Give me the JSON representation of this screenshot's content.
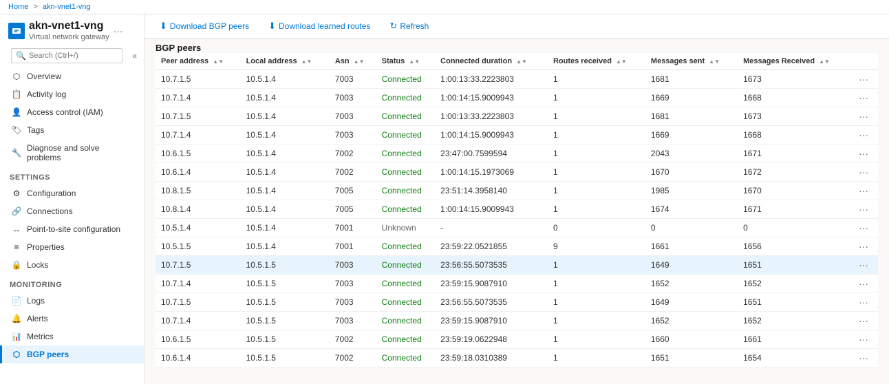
{
  "breadcrumb": {
    "home": "Home",
    "resource": "akn-vnet1-vng"
  },
  "header": {
    "resource_name": "akn-vnet1-vng",
    "separator": "|",
    "page_name": "BGP peers",
    "resource_type": "Virtual network gateway",
    "more_icon": "···"
  },
  "search": {
    "placeholder": "Search (Ctrl+/)"
  },
  "nav": {
    "top_items": [
      {
        "label": "Overview",
        "icon": "overview"
      },
      {
        "label": "Activity log",
        "icon": "activity"
      },
      {
        "label": "Access control (IAM)",
        "icon": "iam"
      },
      {
        "label": "Tags",
        "icon": "tags"
      },
      {
        "label": "Diagnose and solve problems",
        "icon": "diagnose"
      }
    ],
    "sections": [
      {
        "title": "Settings",
        "items": [
          {
            "label": "Configuration",
            "icon": "config"
          },
          {
            "label": "Connections",
            "icon": "connections"
          },
          {
            "label": "Point-to-site configuration",
            "icon": "p2s"
          },
          {
            "label": "Properties",
            "icon": "properties"
          },
          {
            "label": "Locks",
            "icon": "locks"
          }
        ]
      },
      {
        "title": "Monitoring",
        "items": [
          {
            "label": "Logs",
            "icon": "logs"
          },
          {
            "label": "Alerts",
            "icon": "alerts"
          },
          {
            "label": "Metrics",
            "icon": "metrics"
          },
          {
            "label": "BGP peers",
            "icon": "bgp",
            "active": true
          }
        ]
      }
    ]
  },
  "toolbar": {
    "download_bgp_label": "Download BGP peers",
    "download_routes_label": "Download learned routes",
    "refresh_label": "Refresh"
  },
  "table": {
    "section_label": "BGP peers",
    "columns": [
      "Peer address",
      "Local address",
      "Asn",
      "Status",
      "Connected duration",
      "Routes received",
      "Messages sent",
      "Messages Received"
    ],
    "rows": [
      {
        "peer": "10.7.1.5",
        "local": "10.5.1.4",
        "asn": "7003",
        "status": "Connected",
        "duration": "1:00:13:33.2223803",
        "routes": "1",
        "sent": "1681",
        "received": "1673",
        "selected": false
      },
      {
        "peer": "10.7.1.4",
        "local": "10.5.1.4",
        "asn": "7003",
        "status": "Connected",
        "duration": "1:00:14:15.9009943",
        "routes": "1",
        "sent": "1669",
        "received": "1668",
        "selected": false
      },
      {
        "peer": "10.7.1.5",
        "local": "10.5.1.4",
        "asn": "7003",
        "status": "Connected",
        "duration": "1:00:13:33.2223803",
        "routes": "1",
        "sent": "1681",
        "received": "1673",
        "selected": false
      },
      {
        "peer": "10.7.1.4",
        "local": "10.5.1.4",
        "asn": "7003",
        "status": "Connected",
        "duration": "1:00:14:15.9009943",
        "routes": "1",
        "sent": "1669",
        "received": "1668",
        "selected": false
      },
      {
        "peer": "10.6.1.5",
        "local": "10.5.1.4",
        "asn": "7002",
        "status": "Connected",
        "duration": "23:47:00.7599594",
        "routes": "1",
        "sent": "2043",
        "received": "1671",
        "selected": false
      },
      {
        "peer": "10.6.1.4",
        "local": "10.5.1.4",
        "asn": "7002",
        "status": "Connected",
        "duration": "1:00:14:15.1973069",
        "routes": "1",
        "sent": "1670",
        "received": "1672",
        "selected": false
      },
      {
        "peer": "10.8.1.5",
        "local": "10.5.1.4",
        "asn": "7005",
        "status": "Connected",
        "duration": "23:51:14.3958140",
        "routes": "1",
        "sent": "1985",
        "received": "1670",
        "selected": false
      },
      {
        "peer": "10.8.1.4",
        "local": "10.5.1.4",
        "asn": "7005",
        "status": "Connected",
        "duration": "1:00:14:15.9009943",
        "routes": "1",
        "sent": "1674",
        "received": "1671",
        "selected": false
      },
      {
        "peer": "10.5.1.4",
        "local": "10.5.1.4",
        "asn": "7001",
        "status": "Unknown",
        "duration": "-",
        "routes": "0",
        "sent": "0",
        "received": "0",
        "selected": false
      },
      {
        "peer": "10.5.1.5",
        "local": "10.5.1.4",
        "asn": "7001",
        "status": "Connected",
        "duration": "23:59:22.0521855",
        "routes": "9",
        "sent": "1661",
        "received": "1656",
        "selected": false
      },
      {
        "peer": "10.7.1.5",
        "local": "10.5.1.5",
        "asn": "7003",
        "status": "Connected",
        "duration": "23:56:55.5073535",
        "routes": "1",
        "sent": "1649",
        "received": "1651",
        "selected": true
      },
      {
        "peer": "10.7.1.4",
        "local": "10.5.1.5",
        "asn": "7003",
        "status": "Connected",
        "duration": "23:59:15.9087910",
        "routes": "1",
        "sent": "1652",
        "received": "1652",
        "selected": false
      },
      {
        "peer": "10.7.1.5",
        "local": "10.5.1.5",
        "asn": "7003",
        "status": "Connected",
        "duration": "23:56:55.5073535",
        "routes": "1",
        "sent": "1649",
        "received": "1651",
        "selected": false
      },
      {
        "peer": "10.7.1.4",
        "local": "10.5.1.5",
        "asn": "7003",
        "status": "Connected",
        "duration": "23:59:15.9087910",
        "routes": "1",
        "sent": "1652",
        "received": "1652",
        "selected": false
      },
      {
        "peer": "10.6.1.5",
        "local": "10.5.1.5",
        "asn": "7002",
        "status": "Connected",
        "duration": "23:59:19.0622948",
        "routes": "1",
        "sent": "1660",
        "received": "1661",
        "selected": false
      },
      {
        "peer": "10.6.1.4",
        "local": "10.5.1.5",
        "asn": "7002",
        "status": "Connected",
        "duration": "23:59:18.0310389",
        "routes": "1",
        "sent": "1651",
        "received": "1654",
        "selected": false
      }
    ]
  }
}
